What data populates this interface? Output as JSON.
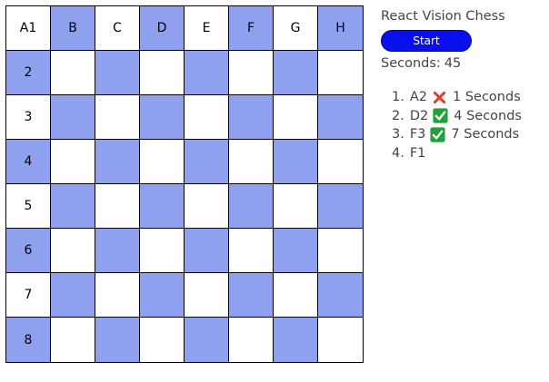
{
  "app": {
    "title": "React Vision Chess"
  },
  "controls": {
    "start_label": "Start"
  },
  "timer": {
    "label": "Seconds:",
    "value": "45"
  },
  "colors": {
    "dark": "#8fa0ee",
    "light": "#ffffff",
    "button": "#0a0ff0",
    "correct": "#22a13a",
    "wrong": "#d9432b"
  },
  "board": {
    "files": [
      "A",
      "B",
      "C",
      "D",
      "E",
      "F",
      "G",
      "H"
    ],
    "ranks": [
      "1",
      "2",
      "3",
      "4",
      "5",
      "6",
      "7",
      "8"
    ],
    "top_labels": [
      "A1",
      "B",
      "C",
      "D",
      "E",
      "F",
      "G",
      "H"
    ],
    "left_labels": [
      "A1",
      "2",
      "3",
      "4",
      "5",
      "6",
      "7",
      "8"
    ]
  },
  "attempts": [
    {
      "num": "1.",
      "square": "A2",
      "result": "wrong",
      "icon": "cross-mark-icon",
      "time": "1 Seconds"
    },
    {
      "num": "2.",
      "square": "D2",
      "result": "correct",
      "icon": "check-mark-icon",
      "time": "4 Seconds"
    },
    {
      "num": "3.",
      "square": "F3",
      "result": "correct",
      "icon": "check-mark-icon",
      "time": "7 Seconds"
    },
    {
      "num": "4.",
      "square": "F1",
      "result": "",
      "icon": "",
      "time": ""
    }
  ]
}
